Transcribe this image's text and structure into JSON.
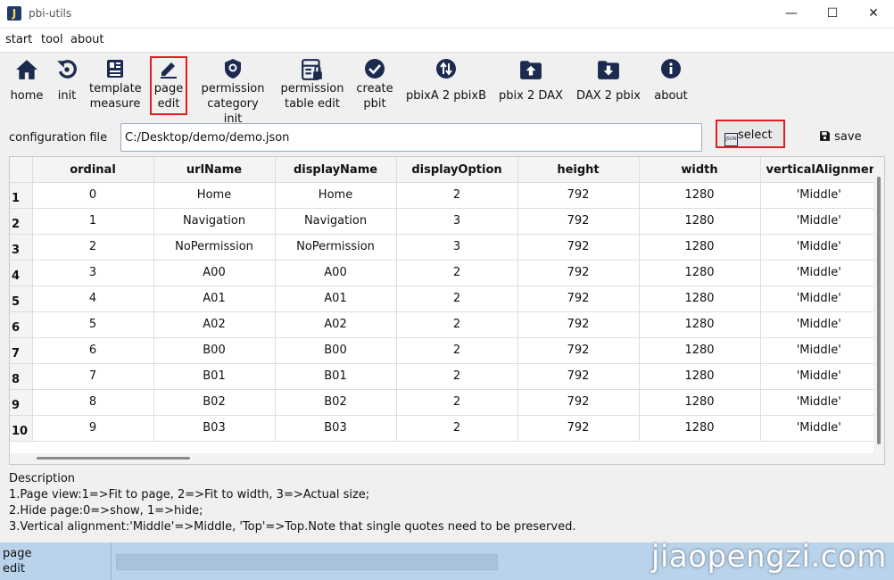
{
  "window": {
    "title": "pbi-utils",
    "icon_letter": "J"
  },
  "menu": [
    "start",
    "tool",
    "about"
  ],
  "toolbar": [
    {
      "label1": "home",
      "label2": "",
      "icon": "home-icon"
    },
    {
      "label1": "init",
      "label2": "",
      "icon": "refresh-icon"
    },
    {
      "label1": "template",
      "label2": "measure",
      "icon": "template-icon"
    },
    {
      "label1": "page",
      "label2": "edit",
      "icon": "pencil-icon"
    },
    {
      "label1": "permission",
      "label2": "category init",
      "icon": "shield-icon"
    },
    {
      "label1": "permission",
      "label2": "table edit",
      "icon": "table-lock-icon"
    },
    {
      "label1": "create",
      "label2": "pbit",
      "icon": "check-circle-icon"
    },
    {
      "label1": "pbixA 2 pbixB",
      "label2": "",
      "icon": "swap-icon"
    },
    {
      "label1": "pbix 2 DAX",
      "label2": "",
      "icon": "folder-up-icon"
    },
    {
      "label1": "DAX 2 pbix",
      "label2": "",
      "icon": "folder-down-icon"
    },
    {
      "label1": "about",
      "label2": "",
      "icon": "info-icon"
    }
  ],
  "config": {
    "label": "configuration file",
    "value": "C:/Desktop/demo/demo.json",
    "select_label": "select",
    "save_label": "save"
  },
  "table": {
    "columns": [
      "ordinal",
      "urlName",
      "displayName",
      "displayOption",
      "height",
      "width",
      "verticalAlignmen"
    ],
    "rows": [
      {
        "n": "1",
        "cells": [
          "0",
          "Home",
          "Home",
          "2",
          "792",
          "1280",
          "'Middle'"
        ]
      },
      {
        "n": "2",
        "cells": [
          "1",
          "Navigation",
          "Navigation",
          "3",
          "792",
          "1280",
          "'Middle'"
        ]
      },
      {
        "n": "3",
        "cells": [
          "2",
          "NoPermission",
          "NoPermission",
          "3",
          "792",
          "1280",
          "'Middle'"
        ]
      },
      {
        "n": "4",
        "cells": [
          "3",
          "A00",
          "A00",
          "2",
          "792",
          "1280",
          "'Middle'"
        ]
      },
      {
        "n": "5",
        "cells": [
          "4",
          "A01",
          "A01",
          "2",
          "792",
          "1280",
          "'Middle'"
        ]
      },
      {
        "n": "6",
        "cells": [
          "5",
          "A02",
          "A02",
          "2",
          "792",
          "1280",
          "'Middle'"
        ]
      },
      {
        "n": "7",
        "cells": [
          "6",
          "B00",
          "B00",
          "2",
          "792",
          "1280",
          "'Middle'"
        ]
      },
      {
        "n": "8",
        "cells": [
          "7",
          "B01",
          "B01",
          "2",
          "792",
          "1280",
          "'Middle'"
        ]
      },
      {
        "n": "9",
        "cells": [
          "8",
          "B02",
          "B02",
          "2",
          "792",
          "1280",
          "'Middle'"
        ]
      },
      {
        "n": "10",
        "cells": [
          "9",
          "B03",
          "B03",
          "2",
          "792",
          "1280",
          "'Middle'"
        ]
      }
    ]
  },
  "description": {
    "title": "Description",
    "line1": "1.Page view:1=>Fit to page, 2=>Fit to width, 3=>Actual size;",
    "line2": "2.Hide page:0=>show, 1=>hide;",
    "line3": "3.Vertical alignment:'Middle'=>Middle, 'Top'=>Top.Note that single quotes need to be preserved."
  },
  "status": {
    "line1": "page",
    "line2": "edit"
  },
  "watermark": "jiaopengzi.com",
  "colors": {
    "accent": "#1b2a4e",
    "highlight": "#e02020",
    "statusbar": "#b9d3eb"
  }
}
